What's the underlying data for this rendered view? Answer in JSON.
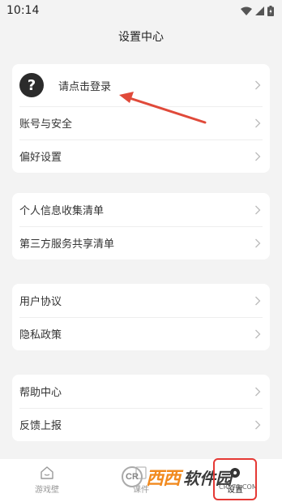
{
  "status_bar": {
    "time": "10:14"
  },
  "header": {
    "title": "设置中心"
  },
  "login": {
    "avatar_symbol": "?",
    "label": "请点击登录"
  },
  "groups": [
    {
      "items": [
        {
          "label": "账号与安全"
        },
        {
          "label": "偏好设置"
        }
      ]
    },
    {
      "items": [
        {
          "label": "个人信息收集清单"
        },
        {
          "label": "第三方服务共享清单"
        }
      ]
    },
    {
      "items": [
        {
          "label": "用户协议"
        },
        {
          "label": "隐私政策"
        }
      ]
    },
    {
      "items": [
        {
          "label": "帮助中心"
        },
        {
          "label": "反馈上报"
        }
      ]
    }
  ],
  "tabbar": {
    "tabs": [
      {
        "label": "游戏壁"
      },
      {
        "label": "课件"
      },
      {
        "label": "设置"
      }
    ],
    "active_index": 2
  },
  "watermark": {
    "brand": "西西",
    "brand2": "软件园",
    "sub": "CR173.COM",
    "logo_letters": "CR"
  },
  "colors": {
    "annotation_red": "#e04a3a",
    "background": "#f3f3f3",
    "card": "#ffffff"
  }
}
